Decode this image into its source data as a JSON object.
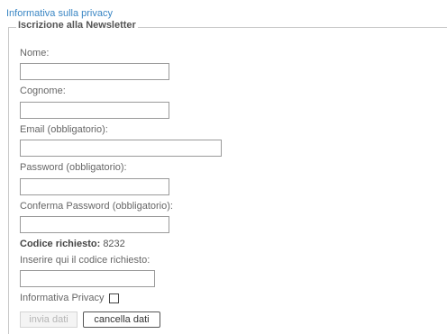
{
  "privacy_link": "Informativa sulla privacy",
  "form": {
    "legend": "Iscrizione alla Newsletter",
    "fields": {
      "nome": {
        "label": "Nome:",
        "value": ""
      },
      "cognome": {
        "label": "Cognome:",
        "value": ""
      },
      "email": {
        "label": "Email (obbligatorio):",
        "value": ""
      },
      "password": {
        "label": "Password (obbligatorio):",
        "value": ""
      },
      "confirm_password": {
        "label": "Conferma Password (obbligatorio):",
        "value": ""
      }
    },
    "code": {
      "key": "Codice richiesto:",
      "value": "8232"
    },
    "code_input": {
      "label": "Inserire qui il codice richiesto:",
      "value": ""
    },
    "privacy_checkbox": {
      "label": "Informativa Privacy",
      "checked": false
    },
    "buttons": {
      "send": "invia dati",
      "clear": "cancella dati"
    }
  }
}
